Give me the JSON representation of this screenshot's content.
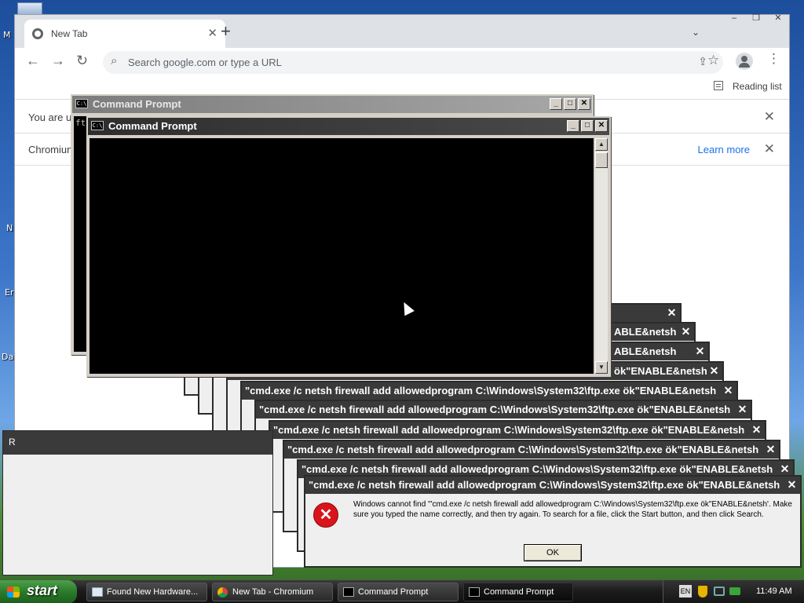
{
  "desktop": {
    "icons": [
      "M",
      "N",
      "Er",
      "Da"
    ]
  },
  "chromium": {
    "tab_title": "New Tab",
    "omnibox_placeholder": "Search google.com or type a URL",
    "reading_list": "Reading list",
    "infobar1_text": "You are us",
    "infobar2_text": "Chromium",
    "learn_more": "Learn more"
  },
  "cmd_back": {
    "title": "Command Prompt",
    "body_text": "ft"
  },
  "cmd_front": {
    "title": "Command Prompt"
  },
  "dialogs": {
    "partial_titles": [
      "ABLE&netsh",
      "ABLE&netsh",
      "ök\"ENABLE&netsh"
    ],
    "title": "\"cmd.exe /c netsh firewall add allowedprogram C:\\Windows\\System32\\ftp.exe ök\"ENABLE&netsh",
    "message": "Windows cannot find '\"cmd.exe /c netsh firewall add allowedprogram C:\\Windows\\System32\\ftp.exe ök\"ENABLE&netsh'. Make sure you typed the name correctly, and then try again. To search for a file, click the Start button, and then click Search.",
    "ok_label": "OK"
  },
  "left_dialog": {
    "title_letter": "R"
  },
  "taskbar": {
    "start_label": "start",
    "items": [
      {
        "label": "Found New Hardware..."
      },
      {
        "label": "New Tab - Chromium"
      },
      {
        "label": "Command Prompt"
      },
      {
        "label": "Command Prompt"
      }
    ],
    "tray_lang": "EN",
    "time": "11:49 AM"
  },
  "colors": {
    "cmd_title_active": "#3c3c3c",
    "cmd_title_inactive": "#8a8a8a",
    "dialog_title": "#3a3a3a",
    "error_red": "#d8151b",
    "link_blue": "#1a73e8"
  }
}
